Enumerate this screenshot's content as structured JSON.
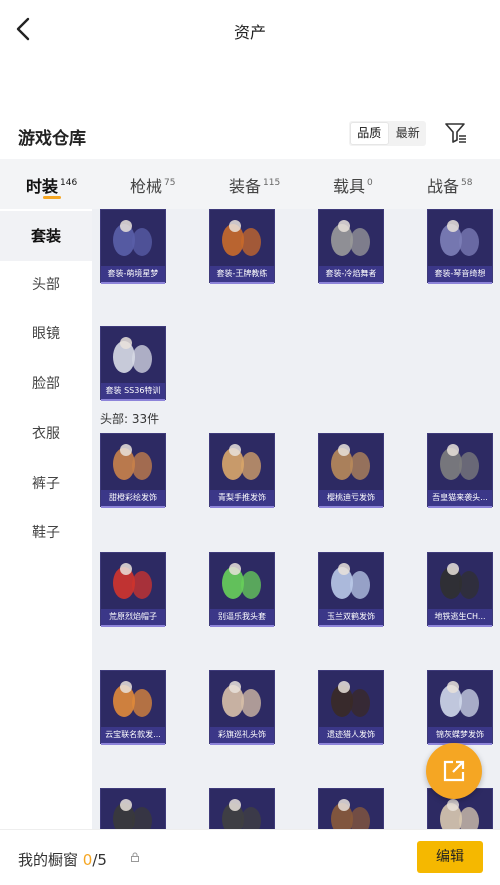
{
  "header": {
    "title": "资产"
  },
  "section": {
    "title": "游戏仓库"
  },
  "sort_options": {
    "quality": "品质",
    "newest": "最新"
  },
  "tabs": [
    {
      "label": "时装",
      "count": "146"
    },
    {
      "label": "枪械",
      "count": "75"
    },
    {
      "label": "装备",
      "count": "115"
    },
    {
      "label": "载具",
      "count": "0"
    },
    {
      "label": "战备",
      "count": "58"
    }
  ],
  "sidebar": [
    {
      "label": "套装"
    },
    {
      "label": "头部"
    },
    {
      "label": "眼镜"
    },
    {
      "label": "脸部"
    },
    {
      "label": "衣服"
    },
    {
      "label": "裤子"
    },
    {
      "label": "鞋子"
    }
  ],
  "groups": {
    "head_title": "头部: 33件"
  },
  "items": [
    {
      "label": "套装-萌境星梦"
    },
    {
      "label": "套装-王牌教练"
    },
    {
      "label": "套装-冷焰舞者"
    },
    {
      "label": "套装-琴音绮想"
    },
    {
      "label": "套装 SS36特训"
    },
    {
      "label": "甜橙彩绘发饰"
    },
    {
      "label": "青梨手推发饰"
    },
    {
      "label": "樱桃迪亏发饰"
    },
    {
      "label": "吾皇猫来袭头..."
    },
    {
      "label": "荒原烈焰帽子"
    },
    {
      "label": "别逼乐我头套"
    },
    {
      "label": "玉兰双鹤发饰"
    },
    {
      "label": "地铁逃生CH..."
    },
    {
      "label": "云宝联名款发..."
    },
    {
      "label": "彩旗巡礼头饰"
    },
    {
      "label": "遗迹猎人发饰"
    },
    {
      "label": "锦灰蝶梦发饰"
    },
    {
      "label": ""
    },
    {
      "label": ""
    },
    {
      "label": ""
    },
    {
      "label": ""
    }
  ],
  "bottom": {
    "label": "我的橱窗",
    "current": "0",
    "total": "/5",
    "edit_label": "编辑"
  },
  "colors": {
    "accent": "#f5a623",
    "card_bg": "#2d2a63",
    "edit_button": "#f5b800"
  }
}
